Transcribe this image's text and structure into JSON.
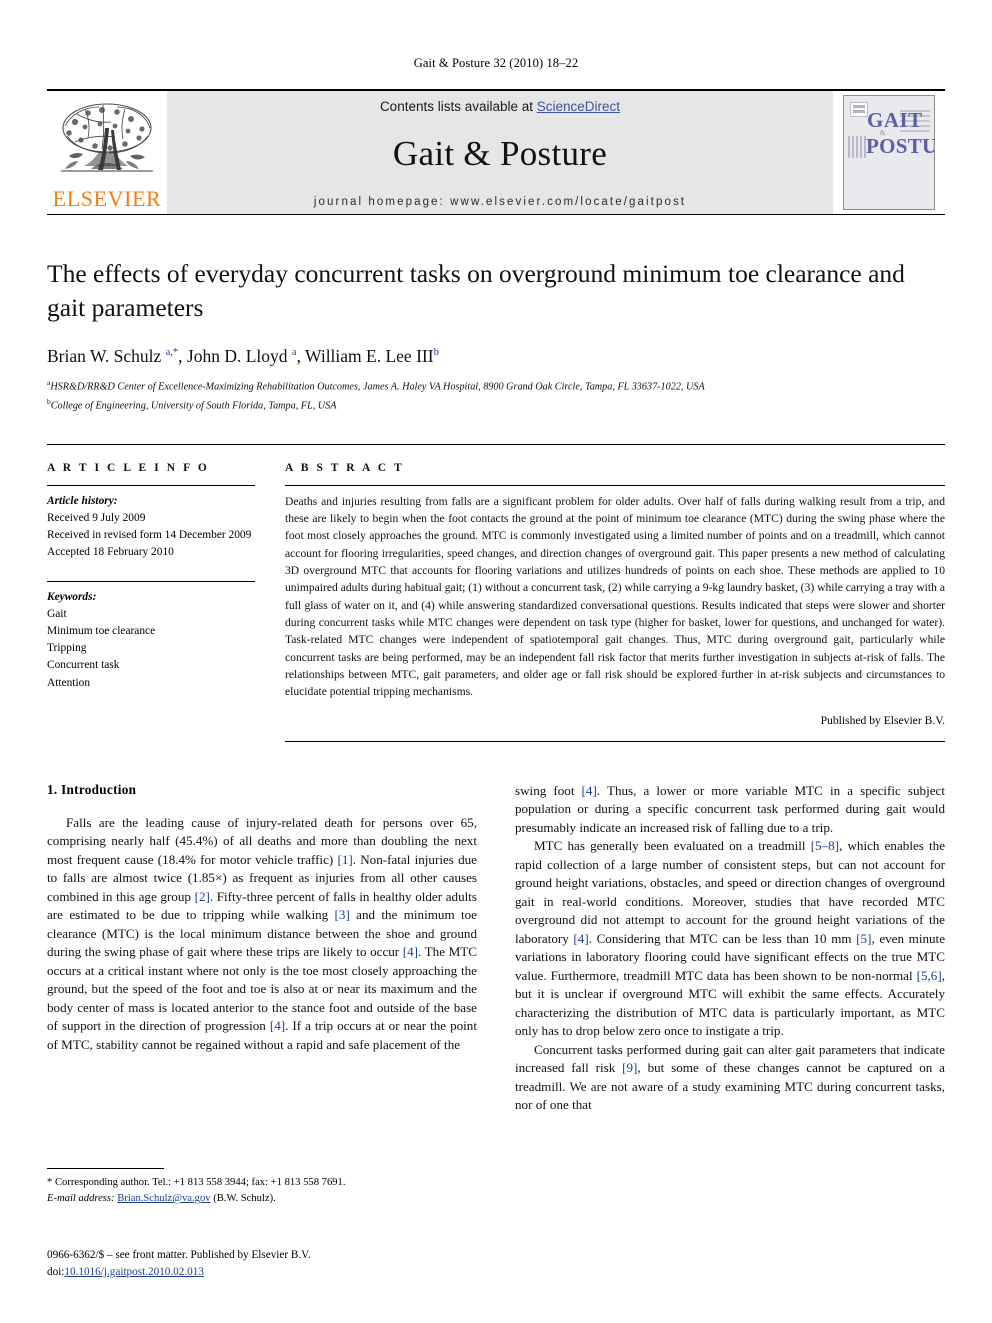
{
  "running_head": "Gait & Posture 32 (2010) 18–22",
  "masthead": {
    "publisher_wordmark": "ELSEVIER",
    "contents_prefix": "Contents lists available at ",
    "contents_link": "ScienceDirect",
    "journal_name": "Gait & Posture",
    "homepage": "journal homepage: www.elsevier.com/locate/gaitpost",
    "cover": {
      "line1": "GAIT",
      "amp": "&",
      "line2": "POSTURE"
    }
  },
  "article": {
    "title": "The effects of everyday concurrent tasks on overground minimum toe clearance and gait parameters",
    "authors_html": "Brian W. Schulz <sup>a,*</sup>, John D. Lloyd <sup>a</sup>, William E. Lee III<sup>b</sup>",
    "affiliation_a": "HSR&D/RR&D Center of Excellence-Maximizing Rehabilitation Outcomes, James A. Haley VA Hospital, 8900 Grand Oak Circle, Tampa, FL 33637-1022, USA",
    "affiliation_b": "College of Engineering, University of South Florida, Tampa, FL, USA"
  },
  "article_info": {
    "heading": "A R T I C L E  I N F O",
    "history_label": "Article history:",
    "history": [
      "Received 9 July 2009",
      "Received in revised form 14 December 2009",
      "Accepted 18 February 2010"
    ],
    "keywords_label": "Keywords:",
    "keywords": [
      "Gait",
      "Minimum toe clearance",
      "Tripping",
      "Concurrent task",
      "Attention"
    ]
  },
  "abstract": {
    "heading": "A B S T R A C T",
    "text": "Deaths and injuries resulting from falls are a significant problem for older adults. Over half of falls during walking result from a trip, and these are likely to begin when the foot contacts the ground at the point of minimum toe clearance (MTC) during the swing phase where the foot most closely approaches the ground. MTC is commonly investigated using a limited number of points and on a treadmill, which cannot account for flooring irregularities, speed changes, and direction changes of overground gait. This paper presents a new method of calculating 3D overground MTC that accounts for flooring variations and utilizes hundreds of points on each shoe. These methods are applied to 10 unimpaired adults during habitual gait; (1) without a concurrent task, (2) while carrying a 9-kg laundry basket, (3) while carrying a tray with a full glass of water on it, and (4) while answering standardized conversational questions. Results indicated that steps were slower and shorter during concurrent tasks while MTC changes were dependent on task type (higher for basket, lower for questions, and unchanged for water). Task-related MTC changes were independent of spatiotemporal gait changes. Thus, MTC during overground gait, particularly while concurrent tasks are being performed, may be an independent fall risk factor that merits further investigation in subjects at-risk of falls. The relationships between MTC, gait parameters, and older age or fall risk should be explored further in at-risk subjects and circumstances to elucidate potential tripping mechanisms.",
    "published_by": "Published by Elsevier B.V."
  },
  "introduction": {
    "heading": "1. Introduction",
    "left_paragraphs": [
      "Falls are the leading cause of injury-related death for persons over 65, comprising nearly half (45.4%) of all deaths and more than doubling the next most frequent cause (18.4% for motor vehicle traffic) [1]. Non-fatal injuries due to falls are almost twice (1.85×) as frequent as injuries from all other causes combined in this age group [2]. Fifty-three percent of falls in healthy older adults are estimated to be due to tripping while walking [3] and the minimum toe clearance (MTC) is the local minimum distance between the shoe and ground during the swing phase of gait where these trips are likely to occur [4]. The MTC occurs at a critical instant where not only is the toe most closely approaching the ground, but the speed of the foot and toe is also at or near its maximum and the body center of mass is located anterior to the stance foot and outside of the base of support in the direction of progression [4]. If a trip occurs at or near the point of MTC, stability cannot be regained without a rapid and safe placement of the"
    ],
    "right_paragraphs": [
      "swing foot [4]. Thus, a lower or more variable MTC in a specific subject population or during a specific concurrent task performed during gait would presumably indicate an increased risk of falling due to a trip.",
      "MTC has generally been evaluated on a treadmill [5–8], which enables the rapid collection of a large number of consistent steps, but can not account for ground height variations, obstacles, and speed or direction changes of overground gait in real-world conditions. Moreover, studies that have recorded MTC overground did not attempt to account for the ground height variations of the laboratory [4]. Considering that MTC can be less than 10 mm [5], even minute variations in laboratory flooring could have significant effects on the true MTC value. Furthermore, treadmill MTC data has been shown to be non-normal [5,6], but it is unclear if overground MTC will exhibit the same effects. Accurately characterizing the distribution of MTC data is particularly important, as MTC only has to drop below zero once to instigate a trip.",
      "Concurrent tasks performed during gait can alter gait parameters that indicate increased fall risk [9], but some of these changes cannot be captured on a treadmill. We are not aware of a study examining MTC during concurrent tasks, nor of one that"
    ]
  },
  "footnotes": {
    "corresponding": "* Corresponding author. Tel.: +1 813 558 3944; fax: +1 813 558 7691.",
    "email_label": "E-mail address:",
    "email": "Brian.Schulz@va.gov",
    "email_suffix": "(B.W. Schulz).",
    "issn_line": "0966-6362/$ – see front matter. Published by Elsevier B.V.",
    "doi_label": "doi:",
    "doi": "10.1016/j.gaitpost.2010.02.013"
  },
  "colors": {
    "link": "#1d3f8f",
    "elsevier_orange": "#f07e13",
    "masthead_grey": "#e6e6e6",
    "cover_purple": "#5a5fa8"
  }
}
